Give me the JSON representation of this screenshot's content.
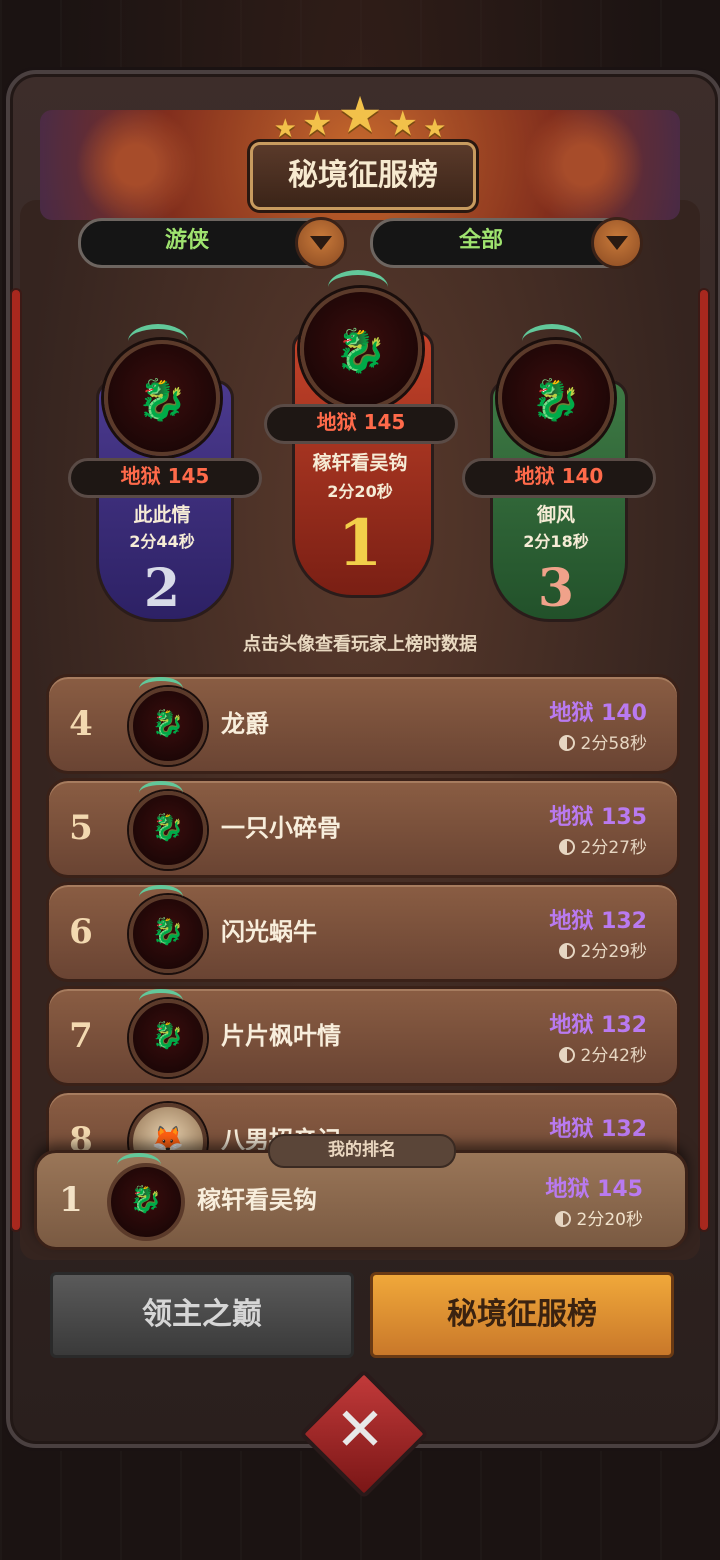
{
  "header": {
    "title": "秘境征服榜",
    "star_count": 5
  },
  "filters": {
    "class_label": "游侠",
    "scope_label": "全部"
  },
  "podium": [
    {
      "rank": "2",
      "score": "地狱 145",
      "name": "此此情",
      "time": "2分44秒"
    },
    {
      "rank": "1",
      "score": "地狱 145",
      "name": "稼轩看吴钩",
      "time": "2分20秒"
    },
    {
      "rank": "3",
      "score": "地狱 140",
      "name": "御风",
      "time": "2分18秒"
    }
  ],
  "hint": "点击头像查看玩家上榜时数据",
  "list": [
    {
      "rank": "4",
      "name": "龙爵",
      "score": "地狱 140",
      "time": "2分58秒"
    },
    {
      "rank": "5",
      "name": "一只小碎骨",
      "score": "地狱 135",
      "time": "2分27秒"
    },
    {
      "rank": "6",
      "name": "闪光蜗牛",
      "score": "地狱 132",
      "time": "2分29秒"
    },
    {
      "rank": "7",
      "name": "片片枫叶情",
      "score": "地狱 132",
      "time": "2分42秒"
    },
    {
      "rank": "8",
      "name": "八男招亲记",
      "score": "地狱 132",
      "time": ""
    }
  ],
  "my_rank": {
    "tag": "我的排名",
    "rank": "1",
    "name": "稼轩看吴钩",
    "score": "地狱 145",
    "time": "2分20秒"
  },
  "tabs": [
    {
      "label": "领主之巅",
      "active": false
    },
    {
      "label": "秘境征服榜",
      "active": true
    }
  ],
  "colors": {
    "score_red": "#ff6a4a",
    "score_purple": "#b97af0",
    "tab_active": "#e0952e",
    "tab_inactive": "#4a4a4a",
    "dropdown_text": "#9fe36f"
  },
  "icons": {
    "close": "close-icon",
    "dropdown": "chevron-down-icon",
    "clock": "clock-icon",
    "avatar": "dragon-avatar-icon"
  }
}
